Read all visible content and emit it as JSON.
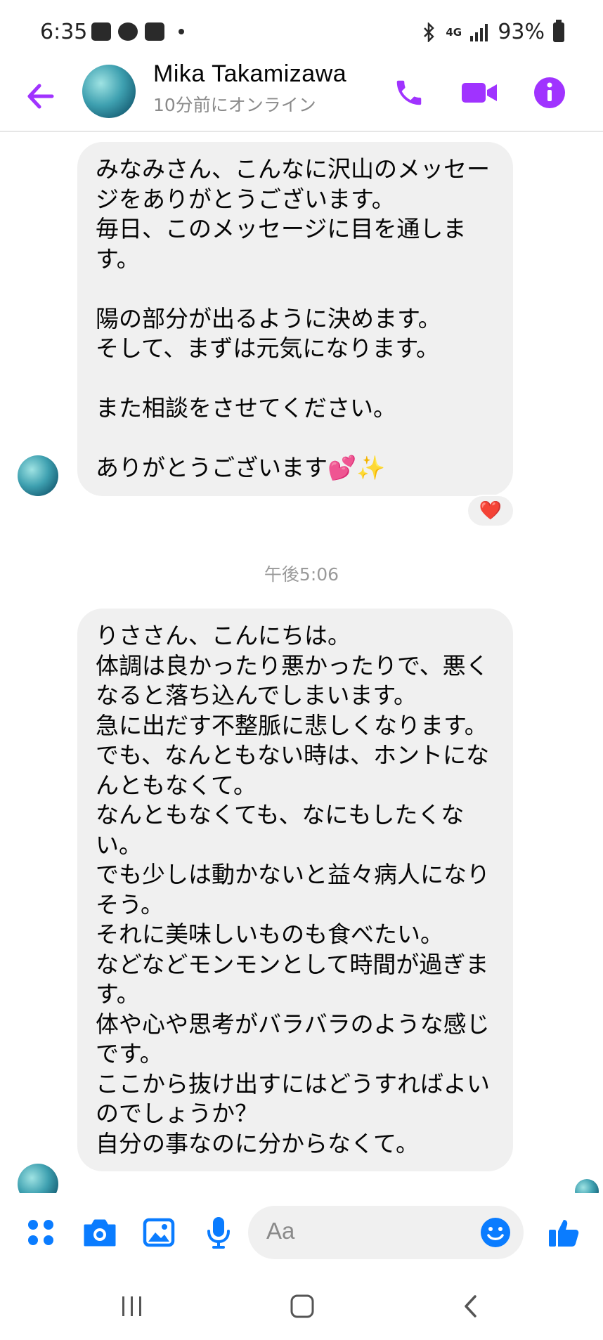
{
  "status_bar": {
    "time": "6:35",
    "network": "4G",
    "battery": "93%",
    "icons": [
      "gallery-icon",
      "line-icon",
      "youtube-icon",
      "bluetooth-icon",
      "signal-icon",
      "battery-icon"
    ]
  },
  "header": {
    "contact_name": "Mika  Takamizawa",
    "contact_status": "10分前にオンライン",
    "accent_color": "#a033ff"
  },
  "messages": [
    {
      "sender": "Mika  Takamizawa",
      "text": "みなみさん、こんなに沢山のメッセージをありがとうございます。\n毎日、このメッセージに目を通します。\n\n陽の部分が出るように決めます。\nそして、まずは元気になります。\n\nまた相談をさせてください。\n\nありがとうございます💕✨",
      "reaction": "❤️"
    },
    {
      "timestamp": "午後5:06"
    },
    {
      "sender": "Mika  Takamizawa",
      "text": "りささん、こんにちは。\n体調は良かったり悪かったりで、悪くなると落ち込んでしまいます。\n急に出だす不整脈に悲しくなります。\nでも、なんともない時は、ホントになんともなくて。\nなんともなくても、なにもしたくない。\nでも少しは動かないと益々病人になりそう。\nそれに美味しいものも食べたい。\nなどなどモンモンとして時間が過ぎます。\n体や心や思考がバラバラのような感じです。\nここから抜け出すにはどうすればよいのでしょうか？\n自分の事なのに分からなくて。"
    }
  ],
  "composer": {
    "placeholder": "Aa",
    "icon_color": "#0a7cff"
  }
}
